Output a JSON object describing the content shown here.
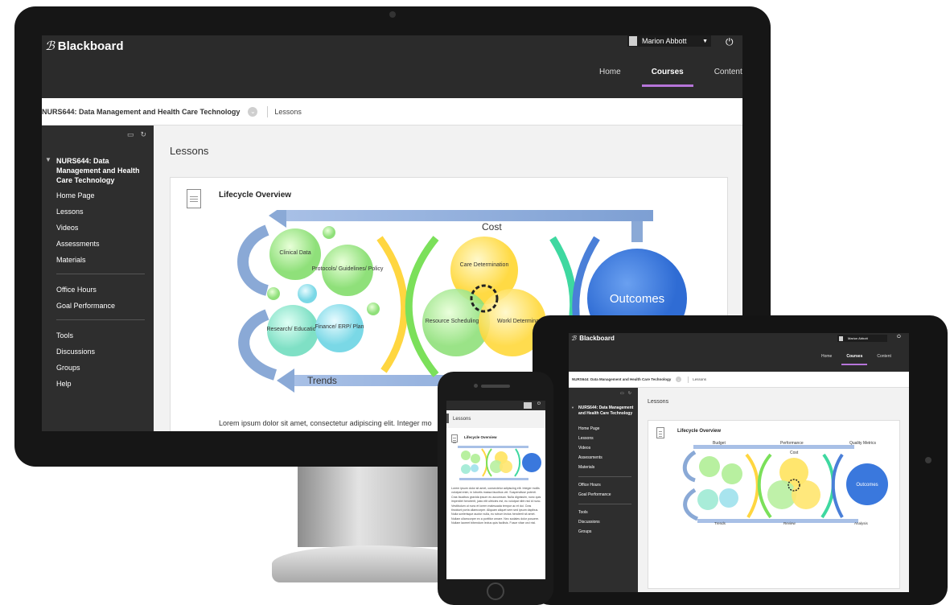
{
  "app": {
    "brand": "Blackboard",
    "logo_mark": "ℬ"
  },
  "user": {
    "name": "Marion Abbott"
  },
  "nav": {
    "home": "Home",
    "courses": "Courses",
    "content": "Content"
  },
  "breadcrumb": {
    "course": "NURS644: Data Management and Health Care Technology",
    "page": "Lessons"
  },
  "sidebar": {
    "course_title": "NURS644: Data Management and Health Care Technology",
    "items": [
      "Home Page",
      "Lessons",
      "Videos",
      "Assessments",
      "Materials"
    ],
    "items2": [
      "Office Hours",
      "Goal Performance"
    ],
    "items3": [
      "Tools",
      "Discussions",
      "Groups",
      "Help"
    ]
  },
  "main": {
    "title": "Lessons",
    "card_title": "Lifecycle Overview",
    "lorem": "Lorem ipsum dolor sit amet, consectetur adipiscing elit. Integer mo",
    "phone_lorem": "Lorem ipsum dolor sit amet, consectetur adipiscing elit. Integer mollis volutpat enim, in lobortis massa faucibus vel. Suspendisse potenti. Cras faucibus gravida ipsum eu accumsan. Nulla dignissim, nunc quis imperdiet hendrerit, justo elit ultricies est, eu volutpat nibh nisl id nunc. Vestibulum ut nunc et lorem malesuada tempor ac et dui. Cras tincidunt porta ullamcorper. Aliquam aliquet sem sed ipsum dapibus. Nulla scelerisque auctor nulla, eu rutrum lectus hendrerit sit amet. Nullam ullamcorper ex a porttitor ornare. Nec sodales dolor posuere. Nullam laoreet bibendum lectus quis facilisis. Fusce vitae orci nisl."
  },
  "diagram": {
    "budget": "Budget",
    "performance": "Performance",
    "quality": "Quality Metrics",
    "cost": "Cost",
    "trends": "Trends",
    "review": "Review",
    "analysis": "Analysis",
    "outcomes": "Outcomes",
    "clinical": "Clinical Data",
    "protocols": "Protocols/ Guidelines/ Policy",
    "research": "Research/ Education",
    "finance": "Finance/ ERP/ Plan",
    "care": "Care Determination",
    "resource": "Resource Scheduling",
    "workload": "Workload Determination",
    "workload_cut": "Workl Determina"
  },
  "colors": {
    "topbar": "#2b2b2b",
    "sidebar": "#2e2e2e",
    "accent": "#b675d9",
    "arrow": "#8aa9d6",
    "outcomes": "#2f6cd4"
  }
}
